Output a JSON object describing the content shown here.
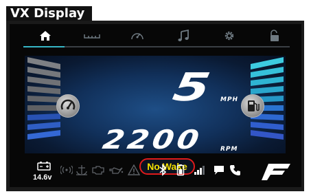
{
  "title": "VX Display",
  "nav": {
    "items": [
      {
        "name": "home-icon",
        "active": true
      },
      {
        "name": "trim-icon"
      },
      {
        "name": "gauge-icon"
      },
      {
        "name": "music-icon"
      },
      {
        "name": "settings-icon"
      },
      {
        "name": "unlock-icon"
      }
    ],
    "accent_color": "#37b7c7"
  },
  "main": {
    "speed_value": "5",
    "speed_unit": "MPH",
    "rpm_value": "2200",
    "rpm_unit": "RPM",
    "status": "No Wake",
    "left_gauge_icon": "tachometer-icon",
    "right_gauge_icon": "fuel-icon",
    "left_bar_levels": {
      "gray_segments": 6,
      "blue_segments": 3
    },
    "right_bar_levels": {
      "teal_segments": 5,
      "blue_segments": 5
    }
  },
  "bottom": {
    "voltage": "14.6v",
    "icons": [
      "battery-icon",
      "radio-icon",
      "anchor-icon",
      "engine-icon",
      "oil-icon",
      "warning-icon",
      "bluetooth-icon",
      "phone-battery-icon",
      "signal-icon",
      "message-icon",
      "call-icon",
      "brand-logo"
    ]
  }
}
